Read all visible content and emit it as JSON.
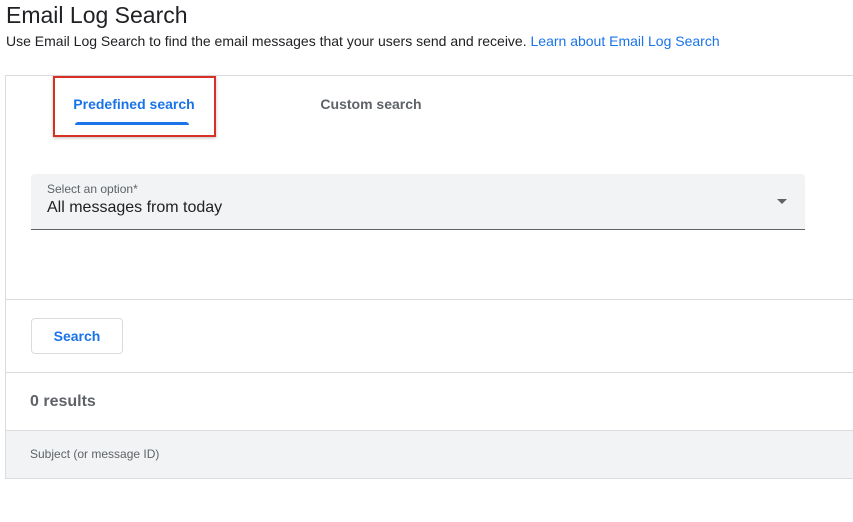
{
  "header": {
    "title": "Email Log Search",
    "description": "Use Email Log Search to find the email messages that your users send and receive.",
    "learn_link": "Learn about Email Log Search"
  },
  "tabs": [
    {
      "label": "Predefined search",
      "active": true
    },
    {
      "label": "Custom search",
      "active": false
    }
  ],
  "select": {
    "label": "Select an option*",
    "value": "All messages from today"
  },
  "search_button": "Search",
  "results": {
    "count_text": "0 results",
    "columns": [
      "Subject (or message ID)"
    ]
  },
  "colors": {
    "accent": "#1a73e8",
    "highlight": "#d93025",
    "text": "#202124",
    "muted": "#5f6368"
  }
}
